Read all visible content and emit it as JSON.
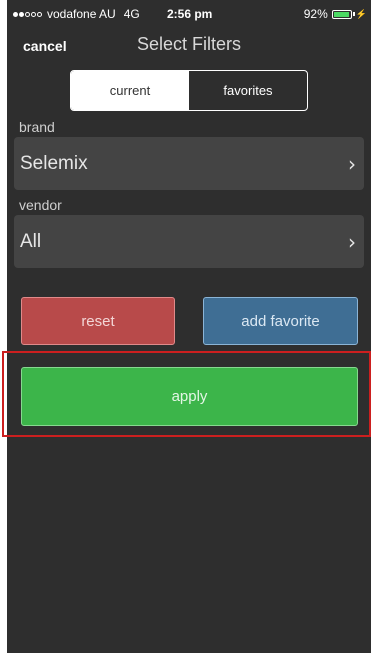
{
  "status_bar": {
    "carrier": "vodafone AU",
    "network": "4G",
    "time": "2:56 pm",
    "battery": "92%",
    "battery_level": 0.92,
    "charging_icon": "bolt-icon"
  },
  "nav": {
    "cancel_label": "cancel",
    "title": "Select Filters"
  },
  "segment": {
    "current_label": "current",
    "favorites_label": "favorites",
    "selected": "current"
  },
  "filters": {
    "brand": {
      "label": "brand",
      "value": "Selemix",
      "chevron": "›"
    },
    "vendor": {
      "label": "vendor",
      "value": "All",
      "chevron": "›"
    }
  },
  "actions": {
    "reset_label": "reset",
    "add_favorite_label": "add favorite",
    "apply_label": "apply"
  },
  "colors": {
    "background": "#2e2e2e",
    "reset": "#b84a4a",
    "add_favorite": "#3f6e94",
    "apply": "#3cb54a",
    "highlight": "#cc1f1f"
  }
}
